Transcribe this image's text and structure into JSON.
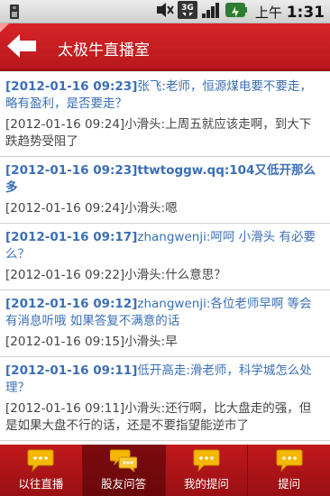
{
  "statusbar": {
    "time_prefix": "上午",
    "time": "1:31",
    "icons": [
      "sim-card-icon",
      "mute-icon",
      "3g-signal-icon",
      "signal-bars-icon",
      "battery-icon"
    ]
  },
  "header": {
    "title": "太极牛直播室",
    "back_icon": "back-arrow-icon"
  },
  "messages": [
    {
      "q_time": "[2012-01-16 09:23]",
      "q_text": "张飞:老师，恒源煤电要不要走，略有盈利，是否要走？",
      "a_time": "[2012-01-16 09:24]",
      "a_text": "小滑头:上周五就应该走啊，到大下跌趋势受阻了"
    },
    {
      "q_time": "[2012-01-16 09:23]",
      "q_text": "ttwtoggw.qq:104又低开那么多",
      "a_time": "[2012-01-16 09:24]",
      "a_text": "小滑头:嗯"
    },
    {
      "q_time": "[2012-01-16 09:17]",
      "q_text": "zhangwenji:呵呵 小滑头 有必要么？",
      "a_time": "[2012-01-16 09:22]",
      "a_text": "小滑头:什么意思？"
    },
    {
      "q_time": "[2012-01-16 09:12]",
      "q_text": "zhangwenji:各位老师早啊 等会有消息听哦 如果答复不满意的话",
      "a_time": "[2012-01-16 09:15]",
      "a_text": "小滑头:早"
    },
    {
      "q_time": "[2012-01-16 09:11]",
      "q_text": "低开高走:滑老师，科学城怎么处理？",
      "a_time": "[2012-01-16 09:11]",
      "a_text": "小滑头:还行啊，比大盘走的强，但是如果大盘不行的话，还是不要指望能逆市了"
    }
  ],
  "tabs": [
    {
      "label": "以往直播",
      "icon": "chat-bubble-icon",
      "active": false
    },
    {
      "label": "股友问答",
      "icon": "conversation-icon",
      "active": true
    },
    {
      "label": "我的提问",
      "icon": "chat-bubble-icon",
      "active": false
    },
    {
      "label": "提问",
      "icon": "chat-bubble-icon",
      "active": false
    }
  ],
  "colors": {
    "title_bar": "#c81e22",
    "question_text": "#3b6fb6",
    "answer_text": "#444444",
    "bubble": "#f5b800"
  }
}
